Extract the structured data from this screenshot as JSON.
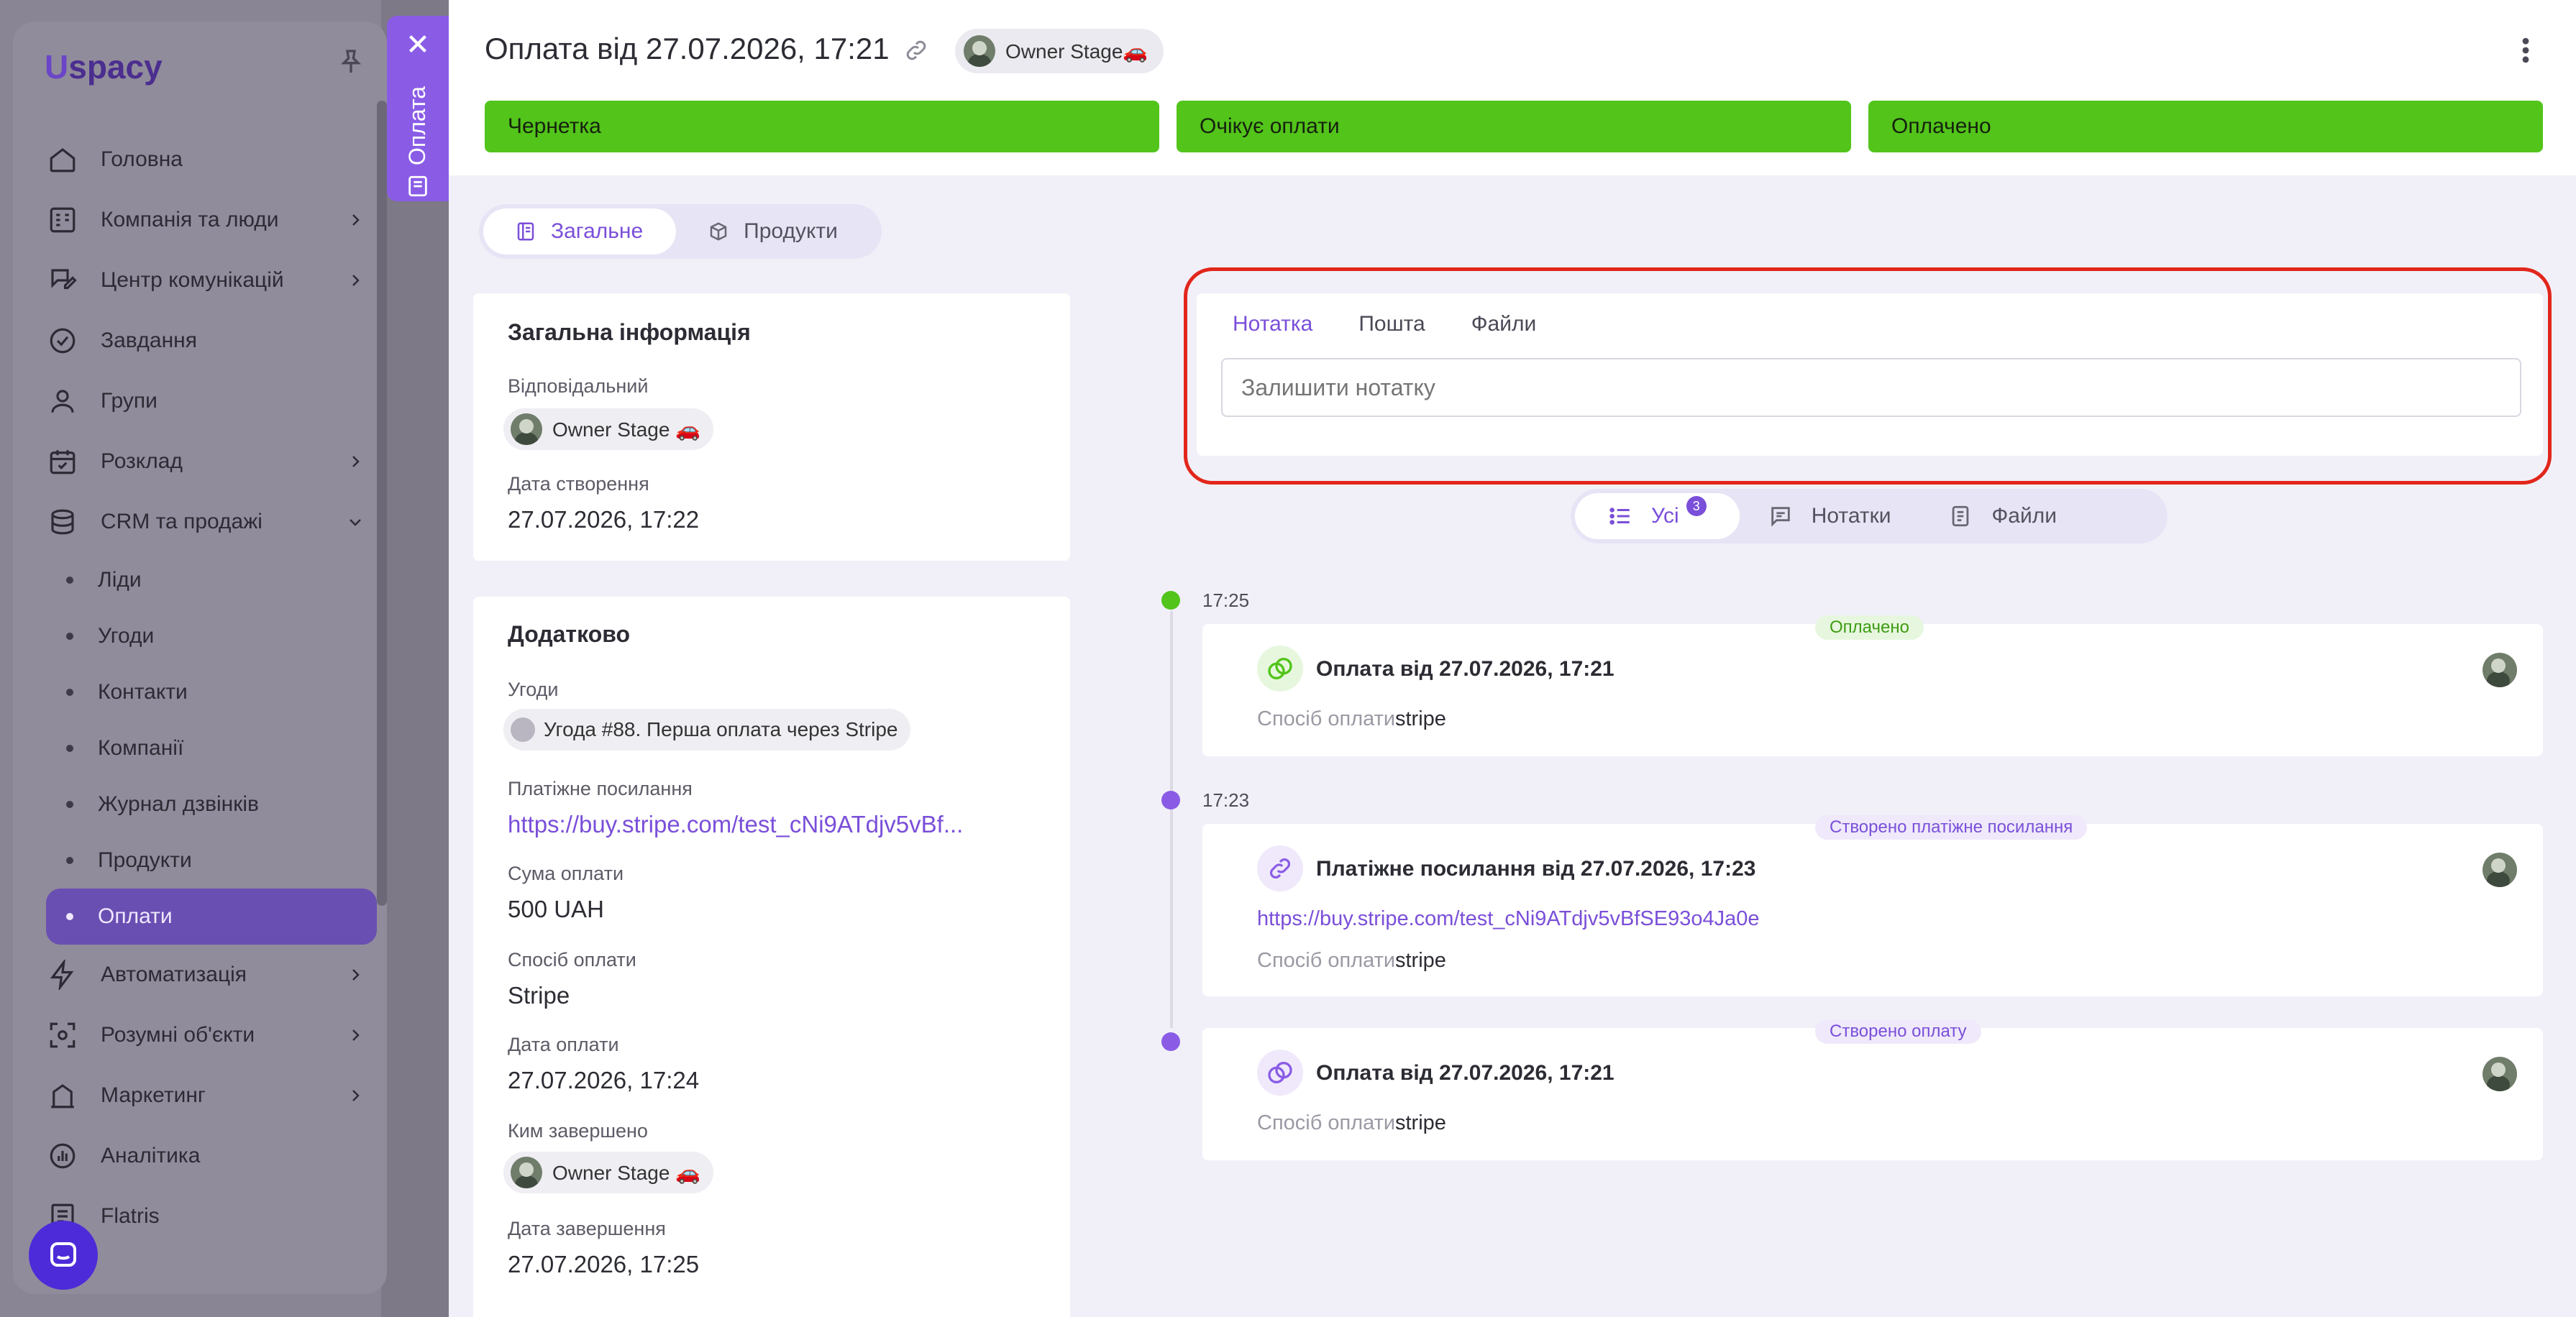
{
  "app": {
    "logo": "spacy",
    "logo_mark": "U",
    "menu": [
      {
        "label": "Головна",
        "icon": "home-icon"
      },
      {
        "label": "Компанія та люди",
        "icon": "company-icon"
      },
      {
        "label": "Центр комунікацій",
        "icon": "chat-edit-icon"
      },
      {
        "label": "Завдання",
        "icon": "check-circle-icon"
      },
      {
        "label": "Групи",
        "icon": "user-icon"
      },
      {
        "label": "Розклад",
        "icon": "calendar-icon"
      },
      {
        "label": "CRM та продажі",
        "icon": "database-icon"
      }
    ],
    "crm_sub": [
      "Ліди",
      "Угоди",
      "Контакти",
      "Компанії",
      "Журнал дзвінків",
      "Продукти",
      "Оплати"
    ],
    "menu_after": [
      {
        "label": "Автоматизація",
        "icon": "bolt-icon"
      },
      {
        "label": "Розумні об'єкти",
        "icon": "smart-object-icon"
      },
      {
        "label": "Маркетинг",
        "icon": "marketing-icon"
      },
      {
        "label": "Аналітика",
        "icon": "analytics-icon"
      },
      {
        "label": "Flatris",
        "icon": "flatris-icon"
      }
    ]
  },
  "side_tab": {
    "label": "Оплата"
  },
  "header": {
    "title": "Оплата від 27.07.2026, 17:21",
    "owner": "Owner Stage🚗",
    "stages": [
      "Чернетка",
      "Очікує оплати",
      "Оплачено"
    ],
    "stage_color": "#52c41a"
  },
  "tabs": [
    {
      "label": "Загальне",
      "active": true
    },
    {
      "label": "Продукти",
      "active": false
    }
  ],
  "general": {
    "title": "Загальна інформація",
    "responsible_label": "Відповідальний",
    "responsible": "Owner Stage 🚗",
    "created_label": "Дата створення",
    "created": "27.07.2026, 17:22"
  },
  "extra": {
    "title": "Додатково",
    "deals_label": "Угоди",
    "deal": "Угода #88. Перша оплата через Stripe",
    "paylink_label": "Платіжне посилання",
    "paylink": "https://buy.stripe.com/test_cNi9ATdjv5vBf...",
    "amount_label": "Сума оплати",
    "amount": "500 UAH",
    "method_label": "Спосіб оплати",
    "method": "Stripe",
    "paid_date_label": "Дата оплати",
    "paid_date": "27.07.2026, 17:24",
    "completed_by_label": "Ким завершено",
    "completed_by": "Owner Stage 🚗",
    "completed_date_label": "Дата завершення",
    "completed_date": "27.07.2026, 17:25"
  },
  "note": {
    "tabs": [
      "Нотатка",
      "Пошта",
      "Файли"
    ],
    "placeholder": "Залишити нотатку"
  },
  "filter": {
    "items": [
      {
        "label": "Усі",
        "badge": "3",
        "active": true
      },
      {
        "label": "Нотатки",
        "active": false
      },
      {
        "label": "Файли",
        "active": false
      }
    ]
  },
  "timeline": [
    {
      "time": "17:25",
      "tag": "Оплачено",
      "tag_color": "#52c41a",
      "title": "Оплата від 27.07.2026, 17:21",
      "method_label": "Спосіб оплати:",
      "method": "stripe"
    },
    {
      "time": "17:23",
      "tag": "Створено платіжне посилання",
      "tag_color": "#7a4fd9",
      "title": "Платіжне посилання від 27.07.2026, 17:23",
      "link": "https://buy.stripe.com/test_cNi9ATdjv5vBfSE93o4Ja0e",
      "method_label": "Спосіб оплати:",
      "method": "stripe"
    },
    {
      "time": "",
      "tag": "Створено оплату",
      "tag_color": "#7a4fd9",
      "title": "Оплата від 27.07.2026, 17:21",
      "method_label": "Спосіб оплати:",
      "method": "stripe"
    }
  ]
}
